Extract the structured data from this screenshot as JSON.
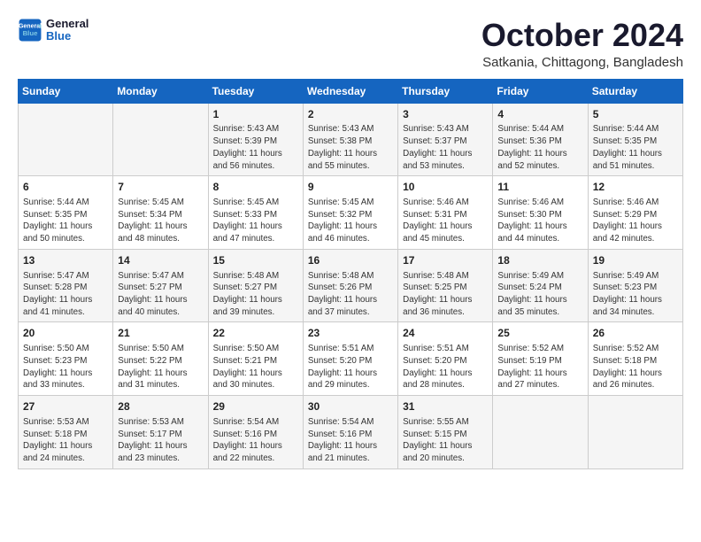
{
  "logo": {
    "line1": "General",
    "line2": "Blue"
  },
  "title": "October 2024",
  "subtitle": "Satkania, Chittagong, Bangladesh",
  "headers": [
    "Sunday",
    "Monday",
    "Tuesday",
    "Wednesday",
    "Thursday",
    "Friday",
    "Saturday"
  ],
  "weeks": [
    [
      {
        "day": "",
        "info": ""
      },
      {
        "day": "",
        "info": ""
      },
      {
        "day": "1",
        "info": "Sunrise: 5:43 AM\nSunset: 5:39 PM\nDaylight: 11 hours and 56 minutes."
      },
      {
        "day": "2",
        "info": "Sunrise: 5:43 AM\nSunset: 5:38 PM\nDaylight: 11 hours and 55 minutes."
      },
      {
        "day": "3",
        "info": "Sunrise: 5:43 AM\nSunset: 5:37 PM\nDaylight: 11 hours and 53 minutes."
      },
      {
        "day": "4",
        "info": "Sunrise: 5:44 AM\nSunset: 5:36 PM\nDaylight: 11 hours and 52 minutes."
      },
      {
        "day": "5",
        "info": "Sunrise: 5:44 AM\nSunset: 5:35 PM\nDaylight: 11 hours and 51 minutes."
      }
    ],
    [
      {
        "day": "6",
        "info": "Sunrise: 5:44 AM\nSunset: 5:35 PM\nDaylight: 11 hours and 50 minutes."
      },
      {
        "day": "7",
        "info": "Sunrise: 5:45 AM\nSunset: 5:34 PM\nDaylight: 11 hours and 48 minutes."
      },
      {
        "day": "8",
        "info": "Sunrise: 5:45 AM\nSunset: 5:33 PM\nDaylight: 11 hours and 47 minutes."
      },
      {
        "day": "9",
        "info": "Sunrise: 5:45 AM\nSunset: 5:32 PM\nDaylight: 11 hours and 46 minutes."
      },
      {
        "day": "10",
        "info": "Sunrise: 5:46 AM\nSunset: 5:31 PM\nDaylight: 11 hours and 45 minutes."
      },
      {
        "day": "11",
        "info": "Sunrise: 5:46 AM\nSunset: 5:30 PM\nDaylight: 11 hours and 44 minutes."
      },
      {
        "day": "12",
        "info": "Sunrise: 5:46 AM\nSunset: 5:29 PM\nDaylight: 11 hours and 42 minutes."
      }
    ],
    [
      {
        "day": "13",
        "info": "Sunrise: 5:47 AM\nSunset: 5:28 PM\nDaylight: 11 hours and 41 minutes."
      },
      {
        "day": "14",
        "info": "Sunrise: 5:47 AM\nSunset: 5:27 PM\nDaylight: 11 hours and 40 minutes."
      },
      {
        "day": "15",
        "info": "Sunrise: 5:48 AM\nSunset: 5:27 PM\nDaylight: 11 hours and 39 minutes."
      },
      {
        "day": "16",
        "info": "Sunrise: 5:48 AM\nSunset: 5:26 PM\nDaylight: 11 hours and 37 minutes."
      },
      {
        "day": "17",
        "info": "Sunrise: 5:48 AM\nSunset: 5:25 PM\nDaylight: 11 hours and 36 minutes."
      },
      {
        "day": "18",
        "info": "Sunrise: 5:49 AM\nSunset: 5:24 PM\nDaylight: 11 hours and 35 minutes."
      },
      {
        "day": "19",
        "info": "Sunrise: 5:49 AM\nSunset: 5:23 PM\nDaylight: 11 hours and 34 minutes."
      }
    ],
    [
      {
        "day": "20",
        "info": "Sunrise: 5:50 AM\nSunset: 5:23 PM\nDaylight: 11 hours and 33 minutes."
      },
      {
        "day": "21",
        "info": "Sunrise: 5:50 AM\nSunset: 5:22 PM\nDaylight: 11 hours and 31 minutes."
      },
      {
        "day": "22",
        "info": "Sunrise: 5:50 AM\nSunset: 5:21 PM\nDaylight: 11 hours and 30 minutes."
      },
      {
        "day": "23",
        "info": "Sunrise: 5:51 AM\nSunset: 5:20 PM\nDaylight: 11 hours and 29 minutes."
      },
      {
        "day": "24",
        "info": "Sunrise: 5:51 AM\nSunset: 5:20 PM\nDaylight: 11 hours and 28 minutes."
      },
      {
        "day": "25",
        "info": "Sunrise: 5:52 AM\nSunset: 5:19 PM\nDaylight: 11 hours and 27 minutes."
      },
      {
        "day": "26",
        "info": "Sunrise: 5:52 AM\nSunset: 5:18 PM\nDaylight: 11 hours and 26 minutes."
      }
    ],
    [
      {
        "day": "27",
        "info": "Sunrise: 5:53 AM\nSunset: 5:18 PM\nDaylight: 11 hours and 24 minutes."
      },
      {
        "day": "28",
        "info": "Sunrise: 5:53 AM\nSunset: 5:17 PM\nDaylight: 11 hours and 23 minutes."
      },
      {
        "day": "29",
        "info": "Sunrise: 5:54 AM\nSunset: 5:16 PM\nDaylight: 11 hours and 22 minutes."
      },
      {
        "day": "30",
        "info": "Sunrise: 5:54 AM\nSunset: 5:16 PM\nDaylight: 11 hours and 21 minutes."
      },
      {
        "day": "31",
        "info": "Sunrise: 5:55 AM\nSunset: 5:15 PM\nDaylight: 11 hours and 20 minutes."
      },
      {
        "day": "",
        "info": ""
      },
      {
        "day": "",
        "info": ""
      }
    ]
  ]
}
